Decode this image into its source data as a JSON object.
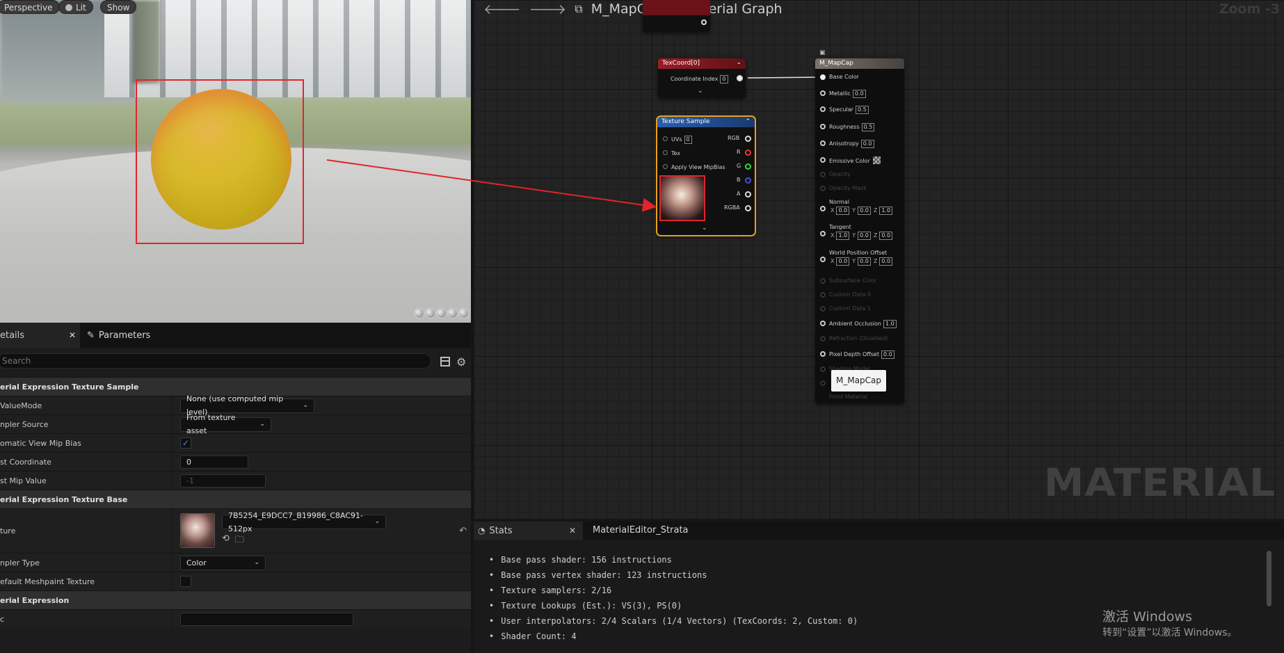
{
  "viewport": {
    "perspective_label": "Perspective",
    "lit_label": "Lit",
    "show_label": "Show"
  },
  "details": {
    "tab_details": "etails",
    "tab_parameters": "Parameters",
    "search_placeholder": "Search",
    "sections": {
      "texture_sample": "erial Expression Texture Sample",
      "texture_base": "erial Expression Texture Base",
      "expression": "erial Expression"
    },
    "rows": {
      "mip_value_mode": {
        "label": "ValueMode",
        "value": "None (use computed mip level)"
      },
      "sampler_source": {
        "label": "npler Source",
        "value": "From texture asset"
      },
      "auto_view_mip_bias": {
        "label": "omatic View Mip Bias",
        "checked": true
      },
      "const_coordinate": {
        "label": "st Coordinate",
        "value": "0"
      },
      "const_mip_value": {
        "label": "st Mip Value",
        "value": "-1"
      },
      "texture": {
        "label": "ture",
        "value": "7B5254_E9DCC7_B19986_C8AC91-512px"
      },
      "sampler_type": {
        "label": "npler Type",
        "value": "Color"
      },
      "default_meshpaint": {
        "label": "efault Meshpaint Texture",
        "checked": false
      },
      "desc": {
        "label": "c",
        "value": ""
      }
    }
  },
  "graph": {
    "title_asset": "M_MapCap",
    "title_graph": "Material Graph",
    "zoom": "Zoom -3",
    "watermark": "MATERIAL",
    "texcoord_node": {
      "title": "TexCoord[0]",
      "coord_label": "Coordinate Index",
      "coord_value": "0"
    },
    "texture_node": {
      "title": "Texture Sample",
      "inputs": [
        "UVs",
        "Tex",
        "Apply View MipBias"
      ],
      "uvs_value": "0",
      "outputs": [
        "RGB",
        "R",
        "G",
        "B",
        "A",
        "RGBA"
      ]
    },
    "material_node": {
      "title": "M_MapCap",
      "pins": [
        {
          "label": "Base Color",
          "value": ""
        },
        {
          "label": "Metallic",
          "value": "0.0"
        },
        {
          "label": "Specular",
          "value": "0.5"
        },
        {
          "label": "Roughness",
          "value": "0.5"
        },
        {
          "label": "Anisotropy",
          "value": "0.0"
        },
        {
          "label": "Emissive Color",
          "value": ""
        },
        {
          "label": "Opacity",
          "value": ""
        },
        {
          "label": "Opacity Mask",
          "value": ""
        },
        {
          "label": "Normal",
          "value": ""
        },
        {
          "label": "Tangent",
          "value": ""
        },
        {
          "label": "World Position Offset",
          "value": ""
        },
        {
          "label": "Subsurface Color",
          "value": ""
        },
        {
          "label": "Custom Data 0",
          "value": ""
        },
        {
          "label": "Custom Data 1",
          "value": ""
        },
        {
          "label": "Ambient Occlusion",
          "value": "1.0"
        },
        {
          "label": "Refraction (Disabled)",
          "value": ""
        },
        {
          "label": "Pixel Depth Offset",
          "value": "0.0"
        },
        {
          "label": "Shading Model",
          "value": ""
        },
        {
          "label": "Front Material",
          "value": ""
        }
      ],
      "normal_xyz": [
        "0.0",
        "0.0",
        "1.0"
      ],
      "tangent_xyz": [
        "1.0",
        "0.0",
        "0.0"
      ],
      "wpo_xyz": [
        "0.0",
        "0.0",
        "0.0"
      ],
      "tooltip": "M_MapCap"
    }
  },
  "stats": {
    "tab_stats": "Stats",
    "tab_strata": "MaterialEditor_Strata",
    "lines": [
      "Base pass shader: 156 instructions",
      "Base pass vertex shader: 123 instructions",
      "Texture samplers: 2/16",
      "Texture Lookups (Est.): VS(3), PS(0)",
      "User interpolators: 2/4 Scalars (1/4 Vectors) (TexCoords: 2, Custom: 0)",
      "Shader Count: 4"
    ]
  },
  "os_notice": {
    "line1": "激活 Windows",
    "line2": "转到“设置”以激活 Windows。"
  },
  "colors": {
    "selection_red": "#e3242b",
    "texcoord_header": "#8a1c22",
    "texture_header": "#1f4a8a",
    "selected_outline": "#e8a21a",
    "material_header": "#6b6560"
  }
}
